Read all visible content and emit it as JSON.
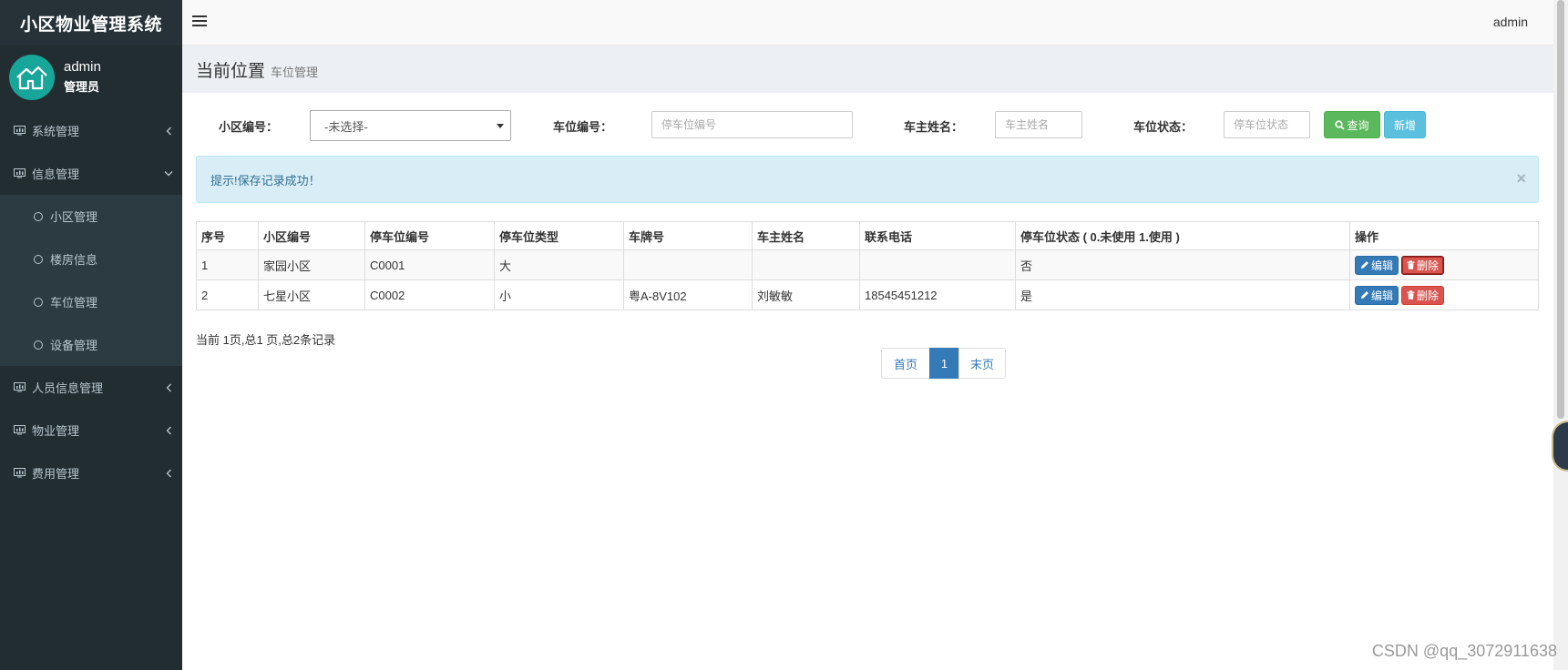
{
  "sidebar": {
    "brand": "小区物业管理系统",
    "user_name": "admin",
    "user_role": "管理员",
    "menu": [
      {
        "label": "系统管理"
      },
      {
        "label": "信息管理"
      },
      {
        "label": "人员信息管理"
      },
      {
        "label": "物业管理"
      },
      {
        "label": "费用管理"
      }
    ],
    "submenu": [
      {
        "label": "小区管理"
      },
      {
        "label": "楼房信息"
      },
      {
        "label": "车位管理"
      },
      {
        "label": "设备管理"
      }
    ]
  },
  "header": {
    "user": "admin"
  },
  "breadcrumb": {
    "title": "当前位置",
    "sub": "车位管理"
  },
  "filter": {
    "community_label": "小区编号：",
    "community_selected": "-未选择-",
    "space_label": "车位编号：",
    "space_placeholder": "停车位编号",
    "owner_label": "车主姓名：",
    "owner_placeholder": "车主姓名",
    "status_label": "车位状态：",
    "status_placeholder": "停车位状态",
    "query_label": "查询",
    "add_label": "新增"
  },
  "alert": {
    "text": "提示!保存记录成功！",
    "close": "×"
  },
  "table": {
    "headers": [
      "序号",
      "小区编号",
      "停车位编号",
      "停车位类型",
      "车牌号",
      "车主姓名",
      "联系电话",
      "停车位状态 ( 0.未使用 1.使用 )",
      "操作"
    ],
    "rows": [
      [
        "1",
        "家园小区",
        "C0001",
        "大",
        "",
        "",
        "",
        "否"
      ],
      [
        "2",
        "七星小区",
        "C0002",
        "小",
        "粤A-8V102",
        "刘敏敏",
        "18545451212",
        "是"
      ]
    ],
    "edit_label": "编辑",
    "delete_label": "删除"
  },
  "pagination": {
    "info": "当前 1页,总1 页,总2条记录",
    "first": "首页",
    "current": "1",
    "last": "末页"
  },
  "watermark": "CSDN @qq_3072911638",
  "colors": {
    "sidebar_bg": "#222d32",
    "primary": "#337ab7",
    "success": "#5cb85c",
    "info": "#5bc0de",
    "danger": "#d9534f",
    "teal_avatar": "#18a59a"
  }
}
